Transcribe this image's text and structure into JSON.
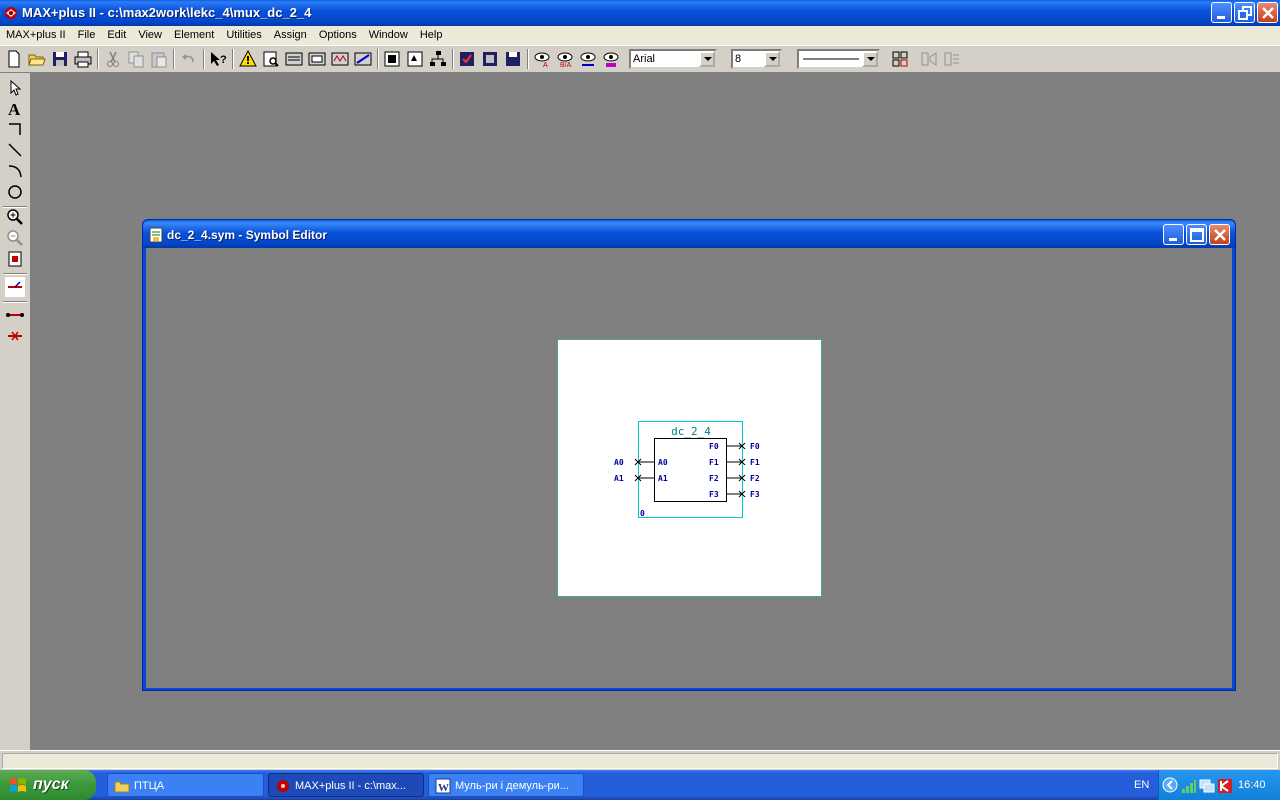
{
  "app": {
    "title": "MAX+plus II - c:\\max2work\\lekc_4\\mux_dc_2_4"
  },
  "menu": [
    "MAX+plus II",
    "File",
    "Edit",
    "View",
    "Element",
    "Utilities",
    "Assign",
    "Options",
    "Window",
    "Help"
  ],
  "toolbar": {
    "font_name": "Arial",
    "font_size": "8"
  },
  "child_window": {
    "title": "dc_2_4.sym - Symbol Editor"
  },
  "symbol": {
    "name": "dc_2_4",
    "inputs": [
      "A0",
      "A1"
    ],
    "outputs": [
      "F0",
      "F1",
      "F2",
      "F3"
    ],
    "instance_number": "0"
  },
  "taskbar": {
    "start_label": "пуск",
    "tasks": [
      {
        "label": "ПТЦА",
        "icon": "folder-icon"
      },
      {
        "label": "MAX+plus II - c:\\max...",
        "icon": "maxplus-icon",
        "active": true
      },
      {
        "label": "Муль-ри і демуль-ри...",
        "icon": "word-icon"
      }
    ],
    "language": "EN",
    "clock": "16:40"
  },
  "colors": {
    "symbol_box": "#00c8c8",
    "pin_text": "#0000a0",
    "symbol_name": "#008080"
  }
}
